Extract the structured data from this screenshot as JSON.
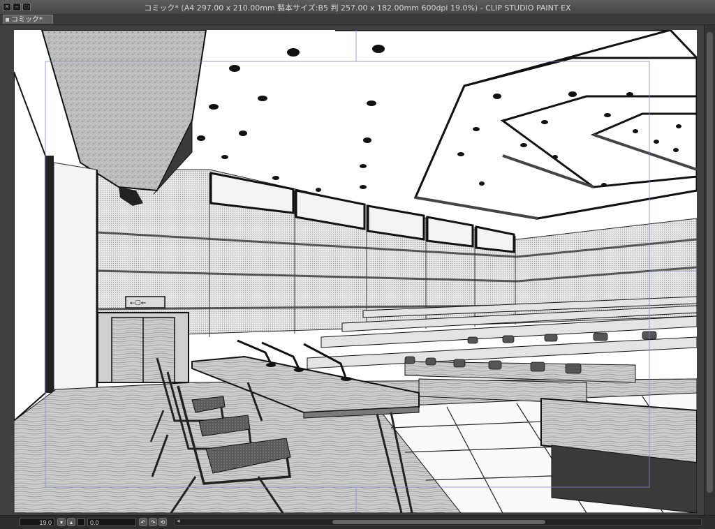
{
  "window": {
    "title": "コミック* (A4 297.00 x 210.00mm 製本サイズ:B5 判 257.00 x 182.00mm 600dpi 19.0%)  - CLIP STUDIO PAINT EX",
    "close_glyph": "✕",
    "minimize_glyph": "–",
    "maximize_glyph": "□"
  },
  "tabs": [
    {
      "label": "コミック*"
    }
  ],
  "canvas": {
    "subject": "lecture hall perspective illustration (manga line art)",
    "background_color": "#ffffff"
  },
  "statusbar": {
    "zoom_value": "19.0",
    "rotation_value": "0.0",
    "zoom_down_glyph": "▾",
    "zoom_up_glyph": "▴",
    "rotate_left_glyph": "↶",
    "rotate_right_glyph": "↷",
    "reset_glyph": "⟲",
    "scroll_left_glyph": "◂"
  },
  "colors": {
    "chrome_dark": "#3c3c3c",
    "title_text": "#d6d6d6"
  }
}
